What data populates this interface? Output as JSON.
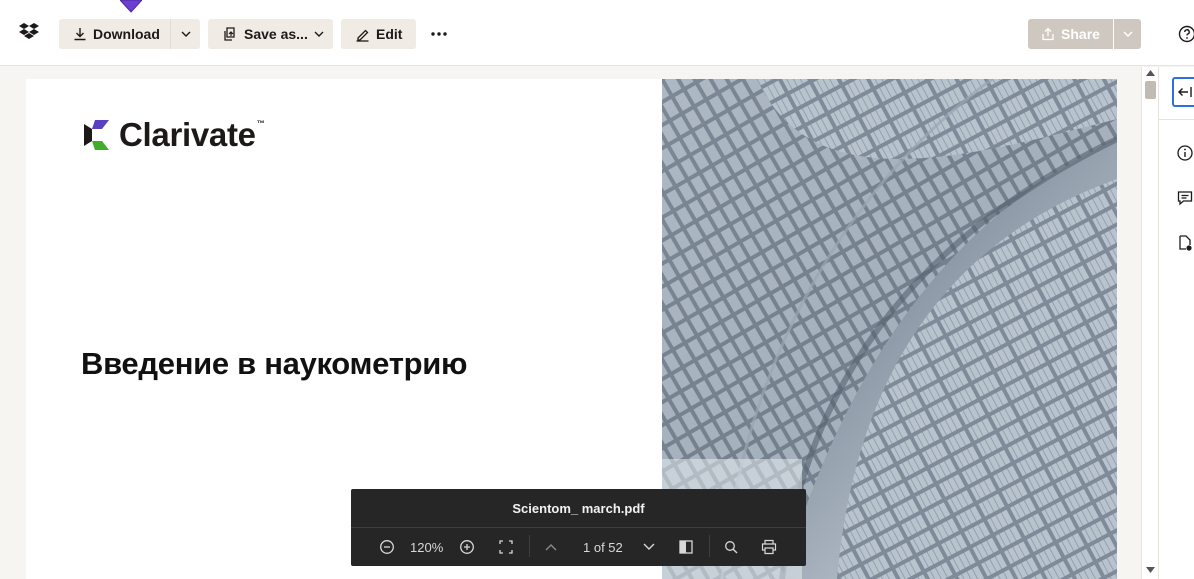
{
  "toolbar": {
    "download_label": "Download",
    "save_as_label": "Save as...",
    "edit_label": "Edit",
    "more_label": "•••",
    "share_label": "Share"
  },
  "document": {
    "brand_name": "Clarivate",
    "brand_tm": "™",
    "title": "Введение в наукометрию"
  },
  "pdf_controls": {
    "file_name": "Scientom_ march.pdf",
    "zoom": "120%",
    "page_indicator": "1 of 52"
  },
  "colors": {
    "accent_blue": "#2f6fe4",
    "cursor_purple": "#6b3fd4",
    "brand_purple": "#5a3fc0",
    "brand_green": "#3fae2a",
    "share_disabled": "#cfc8c0"
  },
  "icons": {
    "app_logo": "dropbox-logo-icon",
    "download": "download-icon",
    "save_as": "save-as-icon",
    "edit": "pencil-icon",
    "help": "help-icon",
    "info": "info-icon",
    "comments": "comment-icon",
    "file_activity": "file-activity-icon"
  }
}
